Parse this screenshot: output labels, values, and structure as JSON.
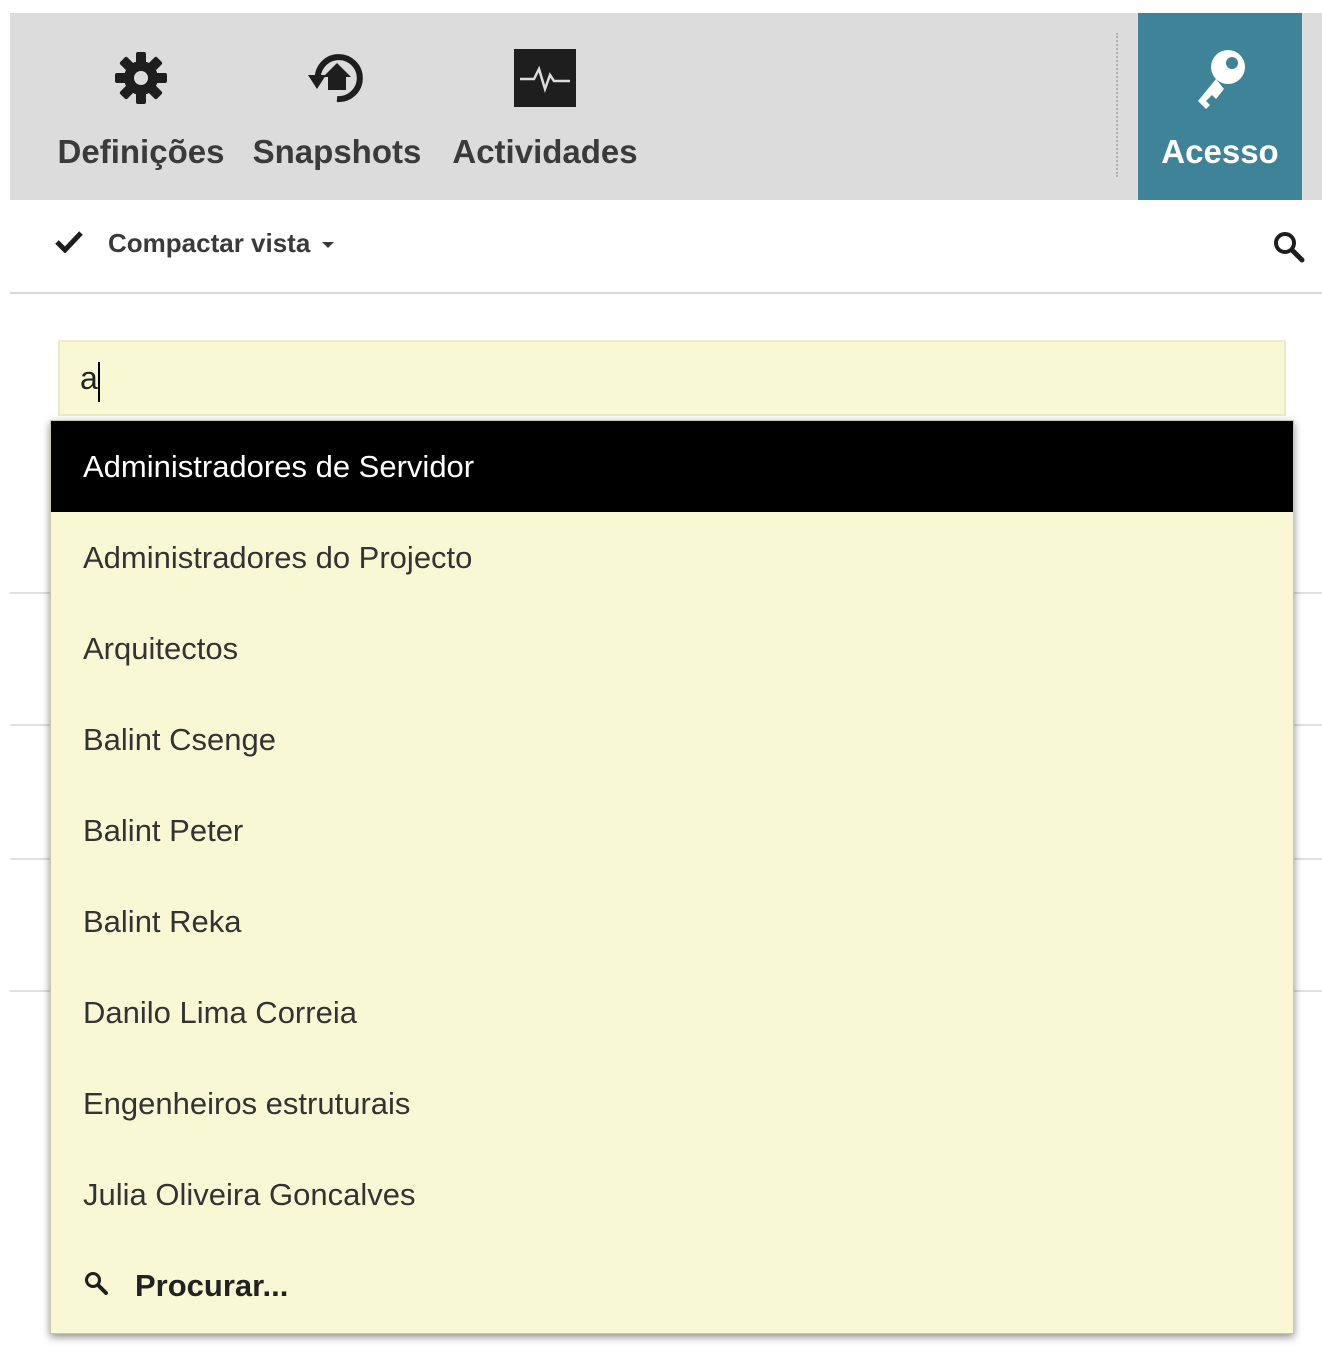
{
  "toolbar": {
    "settings_label": "Definições",
    "snapshots_label": "Snapshots",
    "activities_label": "Actividades",
    "access_label": "Acesso",
    "access_color": "#3f8399"
  },
  "subbar": {
    "compact_label": "Compactar vista"
  },
  "search": {
    "value": "a"
  },
  "dropdown": {
    "selected_bg": "#000000",
    "items": [
      "Administradores de Servidor",
      "Administradores do Projecto",
      "Arquitectos",
      "Balint Csenge",
      "Balint Peter",
      "Balint Reka",
      "Danilo Lima Correia",
      "Engenheiros estruturais",
      "Julia Oliveira Goncalves"
    ],
    "more_label": "Procurar..."
  }
}
